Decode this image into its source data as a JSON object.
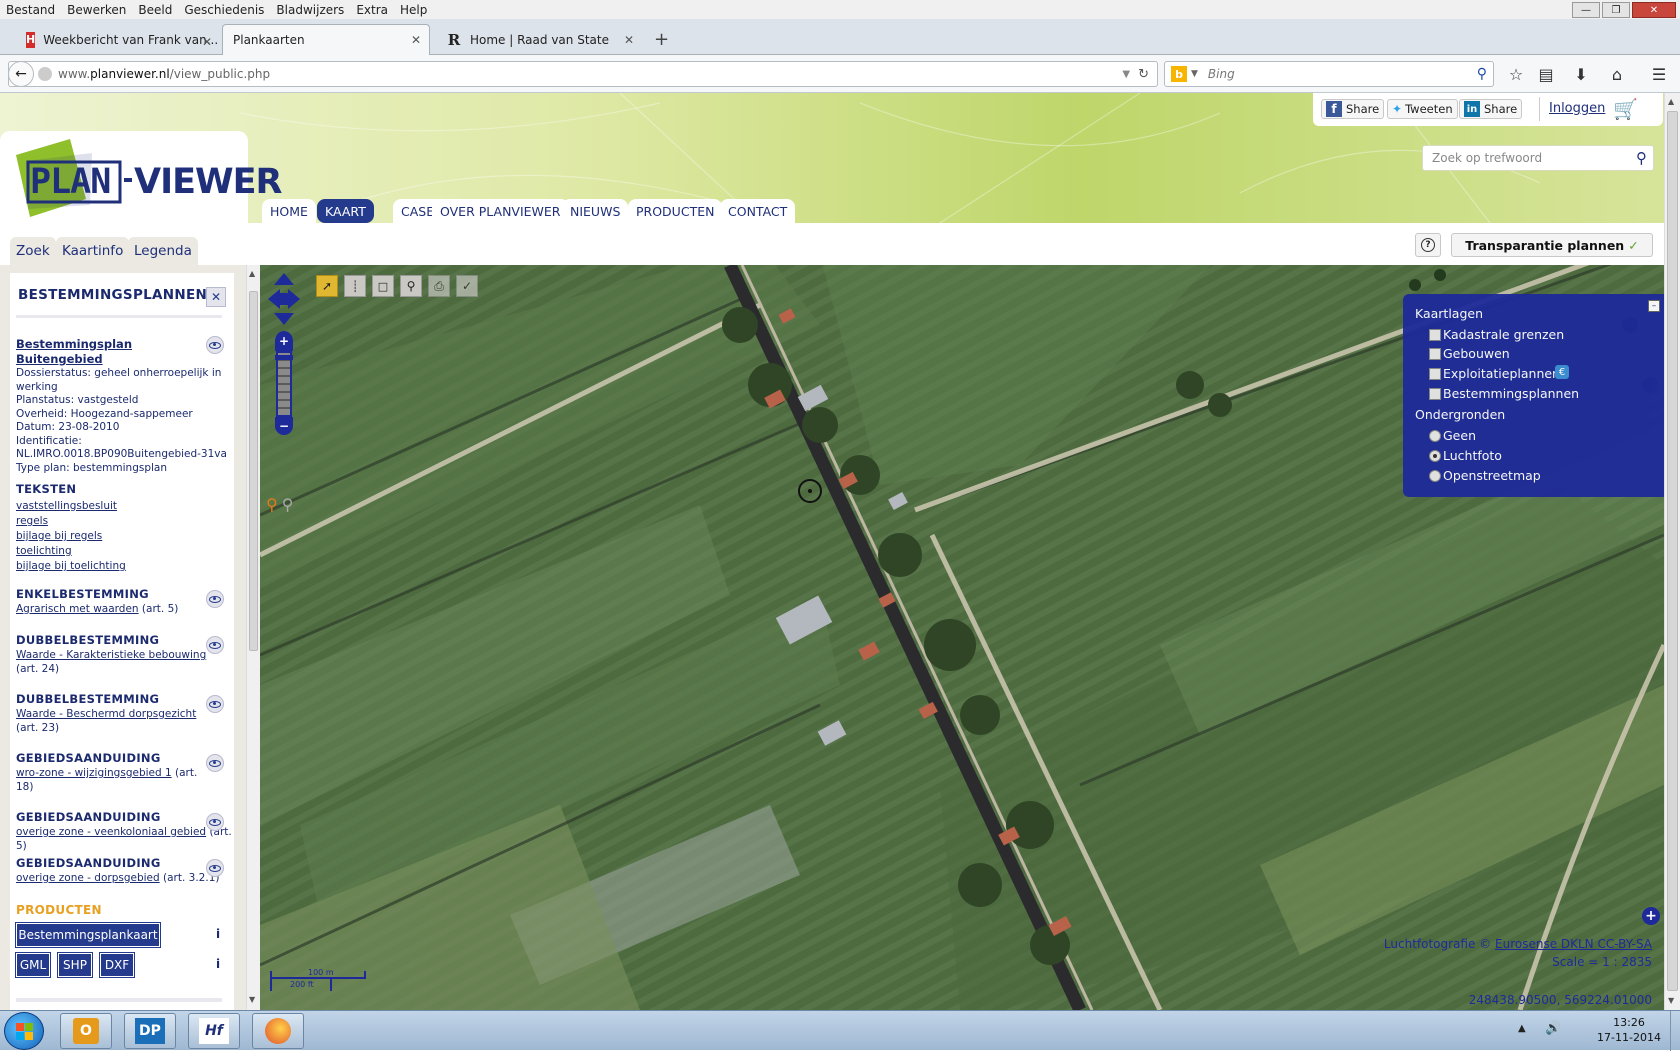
{
  "menubar": {
    "items": [
      "Bestand",
      "Bewerken",
      "Beeld",
      "Geschiedenis",
      "Bladwijzers",
      "Extra",
      "Help"
    ]
  },
  "tabs": [
    {
      "label": "Weekbericht van Frank van...",
      "icon": "hf-icon",
      "active": false
    },
    {
      "label": "Plankaarten",
      "icon": "page-icon",
      "active": true
    },
    {
      "label": "Home | Raad van State",
      "icon": "r-icon",
      "active": false
    }
  ],
  "browser": {
    "url_prefix": "www.",
    "url_domain": "planviewer.nl",
    "url_path": "/view_public.php",
    "search_placeholder": "Bing"
  },
  "site": {
    "logo_text_left": "PLAN",
    "logo_text_right": "VIEWER",
    "nav": [
      "HOME",
      "KAART",
      "CASES",
      "OVER PLANVIEWER",
      "NIEUWS",
      "PRODUCTEN",
      "CONTACT"
    ],
    "nav_active": "KAART",
    "social": {
      "facebook": "Share",
      "twitter": "Tweeten",
      "linkedin": "Share"
    },
    "login": "Inloggen",
    "search_placeholder": "Zoek op trefwoord"
  },
  "panel_tabs": [
    "Zoek",
    "Kaartinfo",
    "Legenda"
  ],
  "help_label": "?",
  "transparency_button": "Transparantie plannen",
  "panel": {
    "title": "BESTEMMINGSPLANNEN",
    "plan_title_1": "Bestemmingsplan",
    "plan_title_2": "Buitengebied",
    "details": [
      "Dossierstatus: geheel onherroepelijk in",
      "werking",
      "Planstatus: vastgesteld",
      "Overheid: Hoogezand-sappemeer",
      "Datum: 23-08-2010",
      "Identificatie:",
      "NL.IMRO.0018.BP090Buitengebied-31va",
      "Type plan: bestemmingsplan"
    ],
    "teksten_head": "TEKSTEN",
    "teksten": [
      "vaststellingsbesluit",
      "regels",
      "bijlage bij regels",
      "toelichting",
      "bijlage bij toelichting"
    ],
    "sections": [
      {
        "head": "ENKELBESTEMMING",
        "link": "Agrarisch met waarden",
        "art": " (art. 5)",
        "link2": "",
        "art2": ""
      },
      {
        "head": "DUBBELBESTEMMING",
        "link": "Waarde - Karakteristieke bebouwing",
        "art": "",
        "link2": "",
        "art2": "(art. 24)"
      },
      {
        "head": "DUBBELBESTEMMING",
        "link": "Waarde - Beschermd dorpsgezicht",
        "art": "",
        "link2": "",
        "art2": "(art. 23)"
      },
      {
        "head": "GEBIEDSAANDUIDING",
        "link": "wro-zone - wijzigingsgebied 1",
        "art": " (art.",
        "link2": "",
        "art2": "18)"
      },
      {
        "head": "GEBIEDSAANDUIDING",
        "link": "overige zone - veenkoloniaal gebied",
        "art": " (art. 5)",
        "link2": "",
        "art2": ""
      },
      {
        "head": "GEBIEDSAANDUIDING",
        "link": "overige zone - dorpsgebied",
        "art": " (art. 3.2.1)",
        "link2": "",
        "art2": ""
      }
    ],
    "producten_head": "PRODUCTEN",
    "product_main": "Bestemmingsplankaart",
    "product_formats": [
      "GML",
      "SHP",
      "DXF"
    ],
    "info": "i"
  },
  "layers": {
    "head": "Kaartlagen",
    "items": [
      "Kadastrale grenzen",
      "Gebouwen",
      "Exploitatieplannen",
      "Bestemmingsplannen"
    ],
    "bases_head": "Ondergronden",
    "bases": [
      "Geen",
      "Luchtfoto",
      "Openstreetmap"
    ],
    "base_selected": "Luchtfoto",
    "euro": "€"
  },
  "map": {
    "attribution_prefix": "Luchtfotografie © ",
    "attribution_link": "Eurosense DKLN CC-BY-SA",
    "scale": "Scale = 1 : 2835",
    "coords": "248438.90500, 569224.01000",
    "scalebar_m": "100 m",
    "scalebar_ft": "200 ft"
  },
  "taskbar": {
    "time": "13:26",
    "date": "17-11-2014",
    "apps": [
      "outlook-icon",
      "dp-icon",
      "hf-icon",
      "firefox-icon"
    ],
    "app_labels": [
      "",
      "DP",
      "Hf",
      ""
    ]
  },
  "colors": {
    "brand": "#243a8c",
    "orange": "#e8a020",
    "layer_panel": "#1e2a9a"
  }
}
